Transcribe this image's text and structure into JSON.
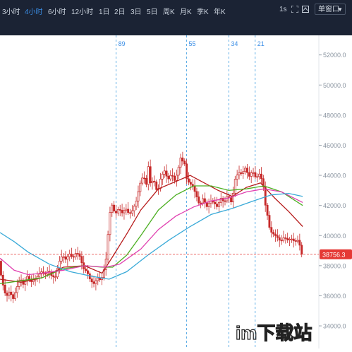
{
  "toolbar": {
    "timeframes": [
      "3小时",
      "4小时",
      "6小时",
      "12小时",
      "1日",
      "2日",
      "3日",
      "5日",
      "周K",
      "月K",
      "季K",
      "年K"
    ],
    "active_timeframe": "4小时",
    "interval_label": "1s",
    "window_button": "单窗口"
  },
  "colors": {
    "toolbar_bg": "#1b2334",
    "active": "#3a8ee6",
    "candle": "#c62828",
    "ma_red": "#b71c1c",
    "ma_green": "#4caf22",
    "ma_magenta": "#e040b0",
    "ma_blue": "#3aaad8",
    "price_line": "#e53935"
  },
  "watermark": "im下载站",
  "chart_data": {
    "type": "candlestick",
    "y_axis_ticks": [
      "52000.0",
      "50000.0",
      "48000.0",
      "46000.0",
      "44000.0",
      "42000.0",
      "40000.0",
      "38000.0",
      "36000.0",
      "34000.0"
    ],
    "ylim": [
      32500,
      53300
    ],
    "fib_markers": [
      {
        "label": "89",
        "x": 0.33
      },
      {
        "label": "55",
        "x": 0.53
      },
      {
        "label": "34",
        "x": 0.65
      },
      {
        "label": "21",
        "x": 0.725
      }
    ],
    "current_price": 38756.3,
    "current_price_label": "38756.3",
    "x_span": 0.86,
    "price_path": [
      [
        0.0,
        38300
      ],
      [
        0.008,
        37000
      ],
      [
        0.014,
        36500
      ],
      [
        0.02,
        35900
      ],
      [
        0.03,
        36300
      ],
      [
        0.04,
        35800
      ],
      [
        0.05,
        36500
      ],
      [
        0.06,
        37200
      ],
      [
        0.07,
        36700
      ],
      [
        0.08,
        37300
      ],
      [
        0.09,
        36900
      ],
      [
        0.1,
        37100
      ],
      [
        0.11,
        37300
      ],
      [
        0.12,
        37600
      ],
      [
        0.13,
        37400
      ],
      [
        0.14,
        37700
      ],
      [
        0.15,
        37300
      ],
      [
        0.16,
        37200
      ],
      [
        0.17,
        38200
      ],
      [
        0.18,
        38700
      ],
      [
        0.19,
        38400
      ],
      [
        0.2,
        38800
      ],
      [
        0.21,
        38500
      ],
      [
        0.22,
        38900
      ],
      [
        0.23,
        38600
      ],
      [
        0.24,
        37800
      ],
      [
        0.25,
        37600
      ],
      [
        0.26,
        37000
      ],
      [
        0.27,
        36800
      ],
      [
        0.28,
        37200
      ],
      [
        0.29,
        37000
      ],
      [
        0.3,
        37900
      ],
      [
        0.305,
        38600
      ],
      [
        0.31,
        40200
      ],
      [
        0.315,
        41500
      ],
      [
        0.32,
        42100
      ],
      [
        0.33,
        41400
      ],
      [
        0.34,
        41800
      ],
      [
        0.35,
        41500
      ],
      [
        0.36,
        41800
      ],
      [
        0.37,
        41400
      ],
      [
        0.38,
        41700
      ],
      [
        0.39,
        42300
      ],
      [
        0.4,
        43400
      ],
      [
        0.41,
        44000
      ],
      [
        0.42,
        43300
      ],
      [
        0.425,
        44800
      ],
      [
        0.43,
        43500
      ],
      [
        0.44,
        43700
      ],
      [
        0.45,
        42800
      ],
      [
        0.46,
        43900
      ],
      [
        0.47,
        44300
      ],
      [
        0.48,
        43700
      ],
      [
        0.49,
        44100
      ],
      [
        0.5,
        43600
      ],
      [
        0.51,
        44500
      ],
      [
        0.515,
        45300
      ],
      [
        0.52,
        44600
      ],
      [
        0.525,
        45600
      ],
      [
        0.53,
        43900
      ],
      [
        0.54,
        43500
      ],
      [
        0.55,
        43300
      ],
      [
        0.56,
        42700
      ],
      [
        0.57,
        42000
      ],
      [
        0.58,
        42500
      ],
      [
        0.59,
        41900
      ],
      [
        0.6,
        42300
      ],
      [
        0.61,
        42200
      ],
      [
        0.62,
        41900
      ],
      [
        0.63,
        42500
      ],
      [
        0.64,
        42200
      ],
      [
        0.65,
        42700
      ],
      [
        0.66,
        42200
      ],
      [
        0.665,
        42800
      ],
      [
        0.67,
        43700
      ],
      [
        0.68,
        44200
      ],
      [
        0.69,
        44100
      ],
      [
        0.7,
        44500
      ],
      [
        0.71,
        43900
      ],
      [
        0.72,
        44300
      ],
      [
        0.73,
        43800
      ],
      [
        0.74,
        44100
      ],
      [
        0.75,
        43500
      ],
      [
        0.755,
        42200
      ],
      [
        0.76,
        41700
      ],
      [
        0.77,
        40300
      ],
      [
        0.78,
        40100
      ],
      [
        0.79,
        39900
      ],
      [
        0.8,
        39600
      ],
      [
        0.81,
        39900
      ],
      [
        0.82,
        39700
      ],
      [
        0.83,
        39800
      ],
      [
        0.84,
        39600
      ],
      [
        0.85,
        39700
      ],
      [
        0.855,
        39300
      ],
      [
        0.86,
        38756
      ]
    ],
    "ma_lines": [
      {
        "color_key": "ma_red",
        "points": [
          [
            0.0,
            37100
          ],
          [
            0.06,
            36900
          ],
          [
            0.12,
            37200
          ],
          [
            0.18,
            37900
          ],
          [
            0.24,
            38000
          ],
          [
            0.29,
            37500
          ],
          [
            0.32,
            38600
          ],
          [
            0.36,
            40100
          ],
          [
            0.4,
            41700
          ],
          [
            0.45,
            43100
          ],
          [
            0.5,
            43600
          ],
          [
            0.54,
            44000
          ],
          [
            0.58,
            43500
          ],
          [
            0.62,
            43000
          ],
          [
            0.66,
            42600
          ],
          [
            0.7,
            43200
          ],
          [
            0.74,
            43500
          ],
          [
            0.78,
            42500
          ],
          [
            0.82,
            41600
          ],
          [
            0.86,
            40600
          ]
        ]
      },
      {
        "color_key": "ma_green",
        "points": [
          [
            0.0,
            36800
          ],
          [
            0.06,
            37000
          ],
          [
            0.12,
            37200
          ],
          [
            0.18,
            37800
          ],
          [
            0.24,
            38000
          ],
          [
            0.29,
            37900
          ],
          [
            0.32,
            37900
          ],
          [
            0.36,
            38700
          ],
          [
            0.4,
            40000
          ],
          [
            0.45,
            41700
          ],
          [
            0.5,
            42700
          ],
          [
            0.55,
            43300
          ],
          [
            0.6,
            43300
          ],
          [
            0.65,
            43000
          ],
          [
            0.7,
            43100
          ],
          [
            0.75,
            43300
          ],
          [
            0.8,
            42900
          ],
          [
            0.86,
            42000
          ]
        ]
      },
      {
        "color_key": "ma_magenta",
        "points": [
          [
            0.0,
            38500
          ],
          [
            0.04,
            37700
          ],
          [
            0.08,
            37400
          ],
          [
            0.12,
            37500
          ],
          [
            0.18,
            37700
          ],
          [
            0.24,
            38000
          ],
          [
            0.3,
            37900
          ],
          [
            0.34,
            38100
          ],
          [
            0.4,
            39100
          ],
          [
            0.45,
            40400
          ],
          [
            0.5,
            41300
          ],
          [
            0.55,
            41900
          ],
          [
            0.6,
            42300
          ],
          [
            0.65,
            42500
          ],
          [
            0.7,
            42900
          ],
          [
            0.75,
            43100
          ],
          [
            0.8,
            42900
          ],
          [
            0.86,
            42200
          ]
        ]
      },
      {
        "color_key": "ma_blue",
        "points": [
          [
            0.0,
            40200
          ],
          [
            0.04,
            39600
          ],
          [
            0.08,
            38900
          ],
          [
            0.14,
            38100
          ],
          [
            0.2,
            37600
          ],
          [
            0.26,
            37300
          ],
          [
            0.31,
            37100
          ],
          [
            0.36,
            37600
          ],
          [
            0.42,
            38700
          ],
          [
            0.48,
            39700
          ],
          [
            0.54,
            40600
          ],
          [
            0.6,
            41400
          ],
          [
            0.66,
            41800
          ],
          [
            0.72,
            42300
          ],
          [
            0.77,
            42700
          ],
          [
            0.82,
            42800
          ],
          [
            0.86,
            42600
          ]
        ]
      }
    ]
  }
}
